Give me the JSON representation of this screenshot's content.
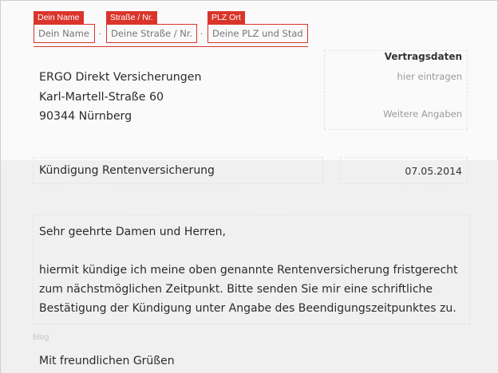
{
  "sender": {
    "name": {
      "label": "Dein Name",
      "placeholder": "Dein Name"
    },
    "street": {
      "label": "Straße / Nr.",
      "placeholder": "Deine Straße / Nr."
    },
    "city": {
      "label": "PLZ Ort",
      "placeholder": "Deine PLZ und Stadt"
    },
    "separator": "·"
  },
  "recipient": {
    "line1": "ERGO Direkt Versicherungen",
    "line2": "Karl-Martell-Straße 60",
    "line3": "90344 Nürnberg"
  },
  "contract": {
    "title": "Vertragsdaten",
    "hint": "hier eintragen",
    "more": "Weitere Angaben"
  },
  "subject": "Kündigung Rentenversicherung",
  "date": "07.05.2014",
  "body": {
    "salutation": "Sehr geehrte Damen und Herren,",
    "line1": "hiermit kündige ich meine oben genannte Rentenversicherung fristgerecht",
    "line2": "zum nächstmöglichen Zeitpunkt. Bitte senden Sie mir eine schriftliche",
    "line3": "Bestätigung  der Kündigung unter Angabe des Beendigungszeitpunktes zu."
  },
  "watermark": "blog",
  "closing": "Mit freundlichen Grüßen"
}
